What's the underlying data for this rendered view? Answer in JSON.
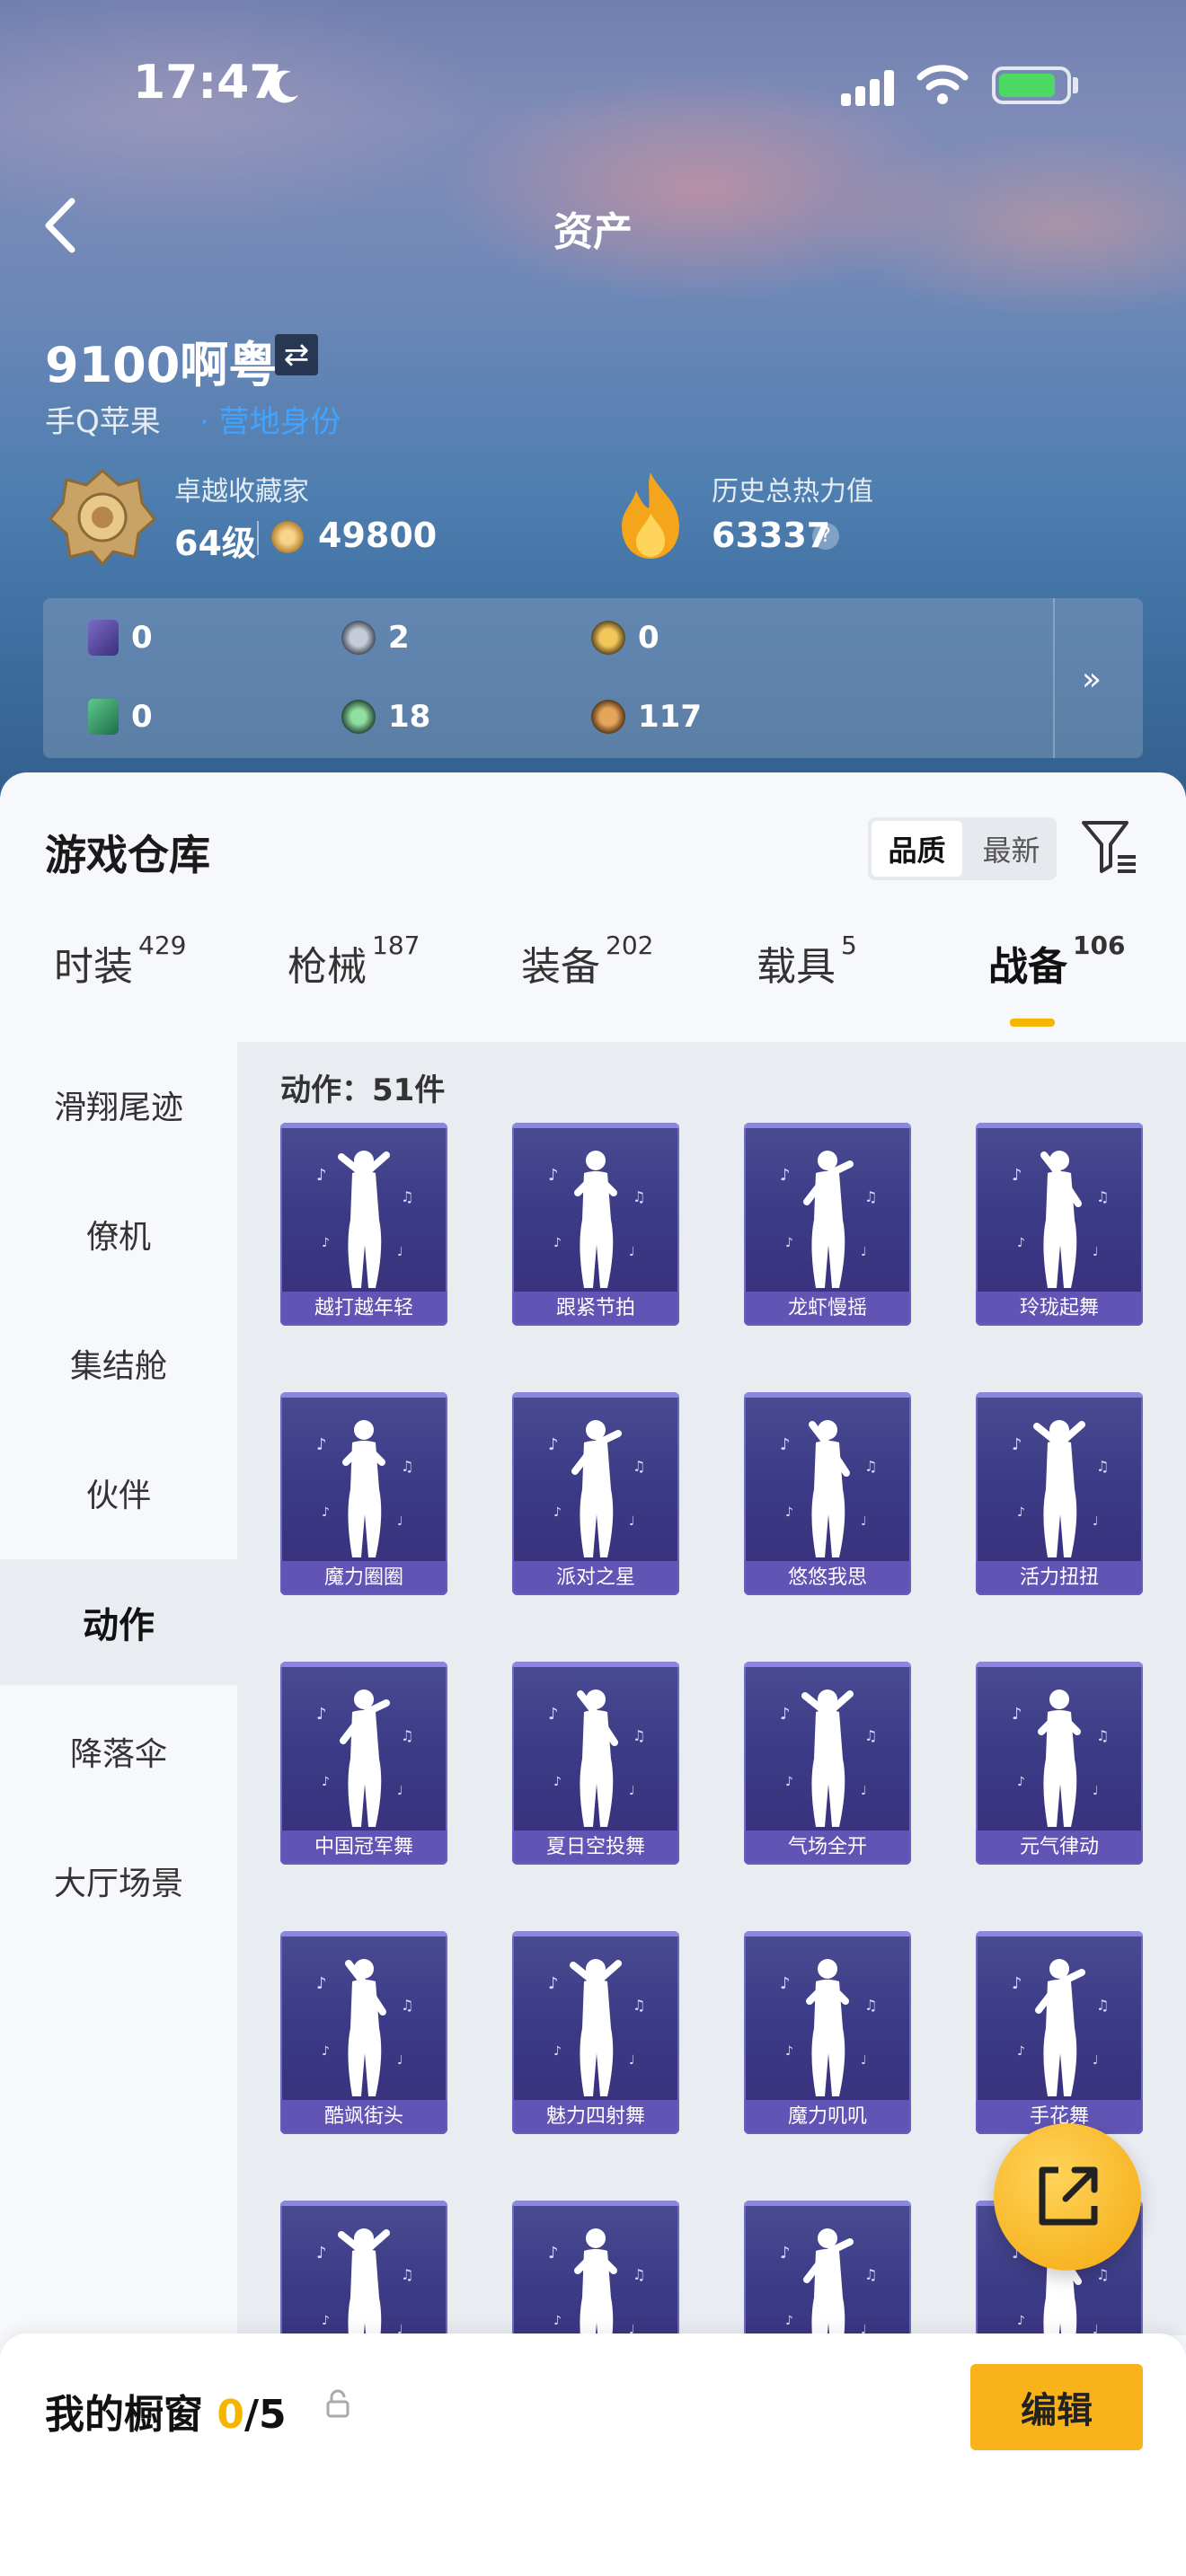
{
  "status_bar": {
    "time": "17:47"
  },
  "nav": {
    "title": "资产"
  },
  "profile": {
    "username": "9100啊粤",
    "platform": "手Q苹果",
    "platform_link": "· 营地身份"
  },
  "collector": {
    "label": "卓越收藏家",
    "level": "64级",
    "coins": "49800"
  },
  "heat": {
    "label": "历史总热力值",
    "value": "63337"
  },
  "currencies": [
    {
      "icon": "purple-card-icon",
      "value": "0"
    },
    {
      "icon": "silver-coin-icon",
      "value": "2"
    },
    {
      "icon": "gold-coin-icon",
      "value": "0"
    },
    {
      "icon": "green-card-icon",
      "value": "0"
    },
    {
      "icon": "green-orb-icon",
      "value": "18"
    },
    {
      "icon": "bronze-coin-icon",
      "value": "117"
    }
  ],
  "warehouse": {
    "title": "游戏仓库",
    "sort_options": [
      "品质",
      "最新"
    ],
    "tabs": [
      {
        "label": "时装",
        "count": "429"
      },
      {
        "label": "枪械",
        "count": "187"
      },
      {
        "label": "装备",
        "count": "202"
      },
      {
        "label": "载具",
        "count": "5"
      },
      {
        "label": "战备",
        "count": "106"
      }
    ],
    "sidebar": [
      "滑翔尾迹",
      "僚机",
      "集结舱",
      "伙伴",
      "动作",
      "降落伞",
      "大厅场景"
    ],
    "count_label": "动作：51件",
    "items": [
      "越打越年轻",
      "跟紧节拍",
      "龙虾慢摇",
      "玲珑起舞",
      "魔力圈圈",
      "派对之星",
      "悠悠我思",
      "活力扭扭",
      "中国冠军舞",
      "夏日空投舞",
      "气场全开",
      "元气律动",
      "酷飒街头",
      "魅力四射舞",
      "魔力叽叽",
      "手花舞",
      "",
      "",
      "",
      ""
    ]
  },
  "vitrine": {
    "title": "我的橱窗",
    "count": "0",
    "total": "/5",
    "edit_label": "编辑"
  },
  "colors": {
    "accent": "#f8b31a",
    "card_purple": "#3b3a86",
    "link_blue": "#3fa4ff"
  }
}
